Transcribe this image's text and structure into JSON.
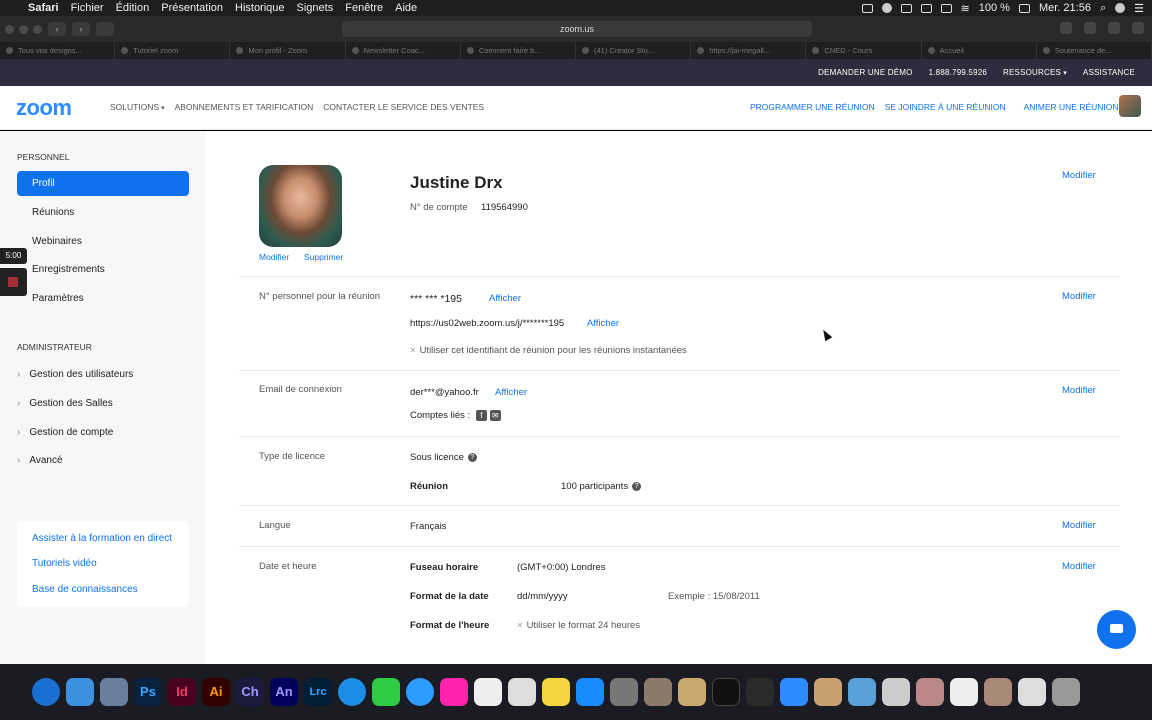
{
  "menubar": {
    "app": "Safari",
    "items": [
      "Fichier",
      "Édition",
      "Présentation",
      "Historique",
      "Signets",
      "Fenêtre",
      "Aide"
    ],
    "battery": "100 %",
    "clock": "Mer. 21:56"
  },
  "browser": {
    "url": "zoom.us",
    "tabs": [
      "Tous vos designs...",
      "Tutoriel zoom",
      "Mon profil - Zoom",
      "Newsletter Coac...",
      "Comment faire b...",
      "(41) Creator Stu...",
      "https://jai-megall...",
      "CNED - Cours",
      "Accueil",
      "Soutenance de..."
    ]
  },
  "topbar": {
    "demo": "DEMANDER UNE DÉMO",
    "phone": "1.888.799.5926",
    "resources": "RESSOURCES",
    "support": "ASSISTANCE"
  },
  "nav": {
    "logo": "zoom",
    "left": [
      "SOLUTIONS",
      "ABONNEMENTS ET TARIFICATION",
      "CONTACTER LE SERVICE DES VENTES"
    ],
    "schedule": "PROGRAMMER UNE RÉUNION",
    "join": "SE JOINDRE À UNE RÉUNION",
    "host": "ANIMER UNE RÉUNION"
  },
  "sidebar": {
    "personal_heading": "PERSONNEL",
    "personal_items": [
      "Profil",
      "Réunions",
      "Webinaires",
      "Enregistrements",
      "Paramètres"
    ],
    "admin_heading": "ADMINISTRATEUR",
    "admin_items": [
      "Gestion des utilisateurs",
      "Gestion des Salles",
      "Gestion de compte",
      "Avancé"
    ],
    "links": [
      "Assister à la formation en direct",
      "Tutoriels vidéo",
      "Base de connaissances"
    ]
  },
  "profile": {
    "name": "Justine Drx",
    "account_label": "N° de compte",
    "account_number": "119564990",
    "photo_edit": "Modifier",
    "photo_delete": "Supprimer",
    "edit": "Modifier",
    "pmi_label": "N° personnel pour la réunion",
    "pmi_value": "*** *** *195",
    "pmi_url": "https://us02web.zoom.us/j/*******195",
    "show": "Afficher",
    "pmi_option": "Utiliser cet identifiant de réunion pour les réunions instantanées",
    "email_label": "Email de connexion",
    "email_value": "der***@yahoo.fr",
    "linked_label": "Comptes liés :",
    "license_label": "Type de licence",
    "license_value": "Sous licence",
    "meeting_label": "Réunion",
    "meeting_value": "100 participants",
    "language_label": "Langue",
    "language_value": "Français",
    "datetime_label": "Date et heure",
    "timezone_label": "Fuseau horaire",
    "timezone_value": "(GMT+0:00) Londres",
    "dateformat_label": "Format de la date",
    "dateformat_value": "dd/mm/yyyy",
    "example_label": "Exemple :",
    "example_value": "15/08/2011",
    "timeformat_label": "Format de l'heure",
    "timeformat_value": "Utiliser le format 24 heures"
  },
  "recorder": {
    "timer": "5:00"
  },
  "dock": {
    "apps": [
      "Ps",
      "Id",
      "Ai",
      "Ch",
      "An",
      "Lrc"
    ]
  }
}
